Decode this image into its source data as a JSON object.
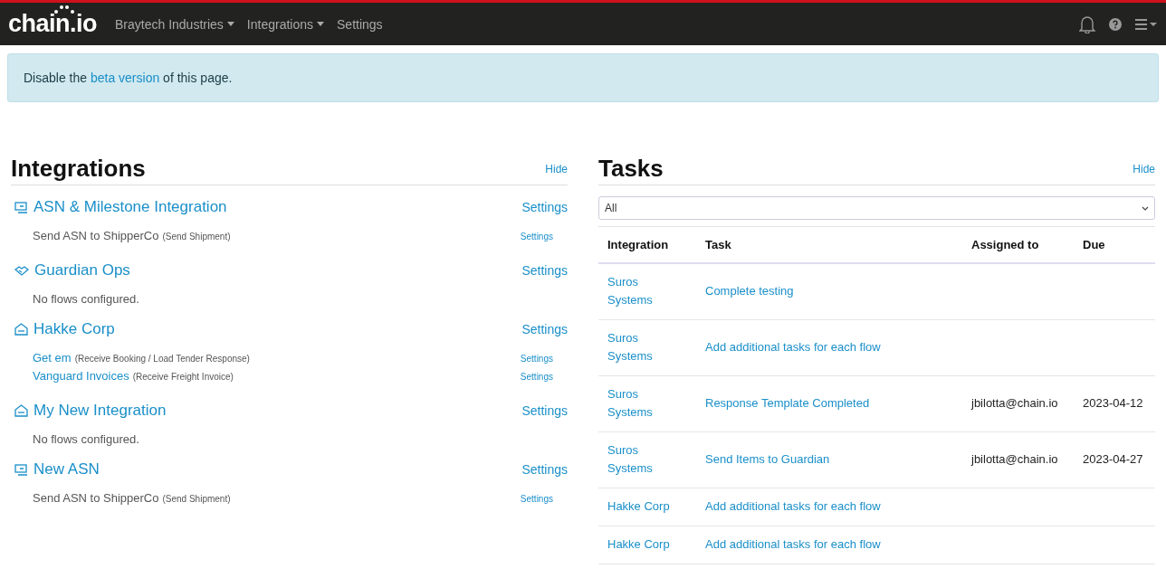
{
  "navbar": {
    "logo": "chain.io",
    "menus": [
      {
        "label": "Braytech Industries",
        "dropdown": true
      },
      {
        "label": "Integrations",
        "dropdown": true
      },
      {
        "label": "Settings",
        "dropdown": false
      }
    ]
  },
  "alert": {
    "before": "Disable the",
    "link": "beta version",
    "after": "of this page."
  },
  "integrations": {
    "title": "Integrations",
    "hide": "Hide",
    "items": [
      {
        "name": "ASN & Milestone Integration",
        "kind": "screen",
        "settings": "Settings",
        "flows": [
          {
            "name": "Send ASN to ShipperCo",
            "linked": false,
            "type": "(Send Shipment)",
            "settings": "Settings"
          }
        ]
      },
      {
        "name": "Guardian Ops",
        "kind": "handshake",
        "settings": "Settings",
        "empty": "No flows configured."
      },
      {
        "name": "Hakke Corp",
        "kind": "building",
        "settings": "Settings",
        "flows": [
          {
            "name": "Get em",
            "linked": true,
            "type": "(Receive Booking / Load Tender Response)",
            "settings": "Settings"
          },
          {
            "name": "Vanguard Invoices",
            "linked": true,
            "type": "(Receive Freight Invoice)",
            "settings": "Settings"
          }
        ]
      },
      {
        "name": "My New Integration",
        "kind": "building",
        "settings": "Settings",
        "empty": "No flows configured."
      },
      {
        "name": "New ASN",
        "kind": "screen",
        "settings": "Settings",
        "flows": [
          {
            "name": "Send ASN to ShipperCo",
            "linked": false,
            "type": "(Send Shipment)",
            "settings": "Settings"
          }
        ]
      }
    ]
  },
  "tasks": {
    "title": "Tasks",
    "hide": "Hide",
    "filter": "All",
    "columns": [
      "Integration",
      "Task",
      "Assigned to",
      "Due"
    ],
    "rows": [
      {
        "integration": "Suros Systems",
        "task": "Complete testing"
      },
      {
        "integration": "Suros Systems",
        "task": "Add additional tasks for each flow"
      },
      {
        "integration": "Suros Systems",
        "task": "Response Template Completed",
        "assigned_to": "jbilotta@chain.io",
        "due": "2023-04-12"
      },
      {
        "integration": "Suros Systems",
        "task": "Send Items to Guardian",
        "assigned_to": "jbilotta@chain.io",
        "due": "2023-04-27"
      },
      {
        "integration": "Hakke Corp",
        "task": "Add additional tasks for each flow"
      },
      {
        "integration": "Hakke Corp",
        "task": "Add additional tasks for each flow"
      }
    ]
  }
}
